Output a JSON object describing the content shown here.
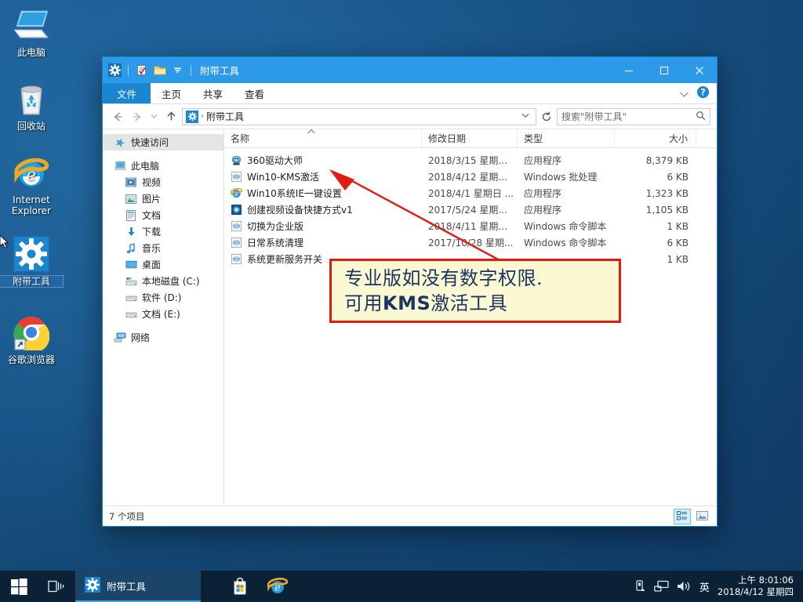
{
  "desktop": {
    "icons": [
      {
        "label": "此电脑",
        "icon": "computer-icon",
        "selected": false
      },
      {
        "label": "回收站",
        "icon": "recycle-bin-icon",
        "selected": false
      },
      {
        "label": "Internet\nExplorer",
        "label_l1": "Internet",
        "label_l2": "Explorer",
        "icon": "internet-explorer-icon",
        "selected": false
      },
      {
        "label": "附带工具",
        "icon": "gear-icon",
        "selected": true
      },
      {
        "label": "谷歌浏览器",
        "icon": "chrome-icon",
        "selected": false
      }
    ]
  },
  "explorer": {
    "window_title": "附带工具",
    "quick_access_toolbar": {
      "folder_icon": "gear-icon",
      "properties_icon": "properties-icon",
      "new_folder_icon": "new-folder-icon",
      "customize_icon": "chevron-down-icon"
    },
    "window_controls": {
      "minimize": "–",
      "maximize": "❐",
      "close": "✕"
    },
    "ribbon": {
      "tabs": [
        {
          "label": "文件",
          "active": true
        },
        {
          "label": "主页",
          "active": false
        },
        {
          "label": "共享",
          "active": false
        },
        {
          "label": "查看",
          "active": false
        }
      ],
      "collapse_icon": "chevron-down-icon",
      "help_icon": "help-icon"
    },
    "navigation": {
      "back_icon": "arrow-left-icon",
      "forward_icon": "arrow-right-icon",
      "recent_icon": "chevron-down-icon",
      "up_icon": "arrow-up-icon",
      "breadcrumb_icon": "gear-icon",
      "breadcrumb_path": "附带工具",
      "breadcrumb_separator": "›",
      "dropdown_icon": "chevron-down-icon",
      "refresh_icon": "refresh-icon"
    },
    "search": {
      "placeholder": "搜索\"附带工具\"",
      "value": "",
      "icon": "search-icon"
    },
    "nav_pane": {
      "items": [
        {
          "label": "快速访问",
          "icon": "star-pin-icon",
          "indent": 0,
          "selected": true
        },
        {
          "label": "此电脑",
          "icon": "computer-icon",
          "indent": 0,
          "selected": false
        },
        {
          "label": "视频",
          "icon": "videos-icon",
          "indent": 1,
          "selected": false
        },
        {
          "label": "图片",
          "icon": "pictures-icon",
          "indent": 1,
          "selected": false
        },
        {
          "label": "文档",
          "icon": "documents-icon",
          "indent": 1,
          "selected": false
        },
        {
          "label": "下载",
          "icon": "downloads-icon",
          "indent": 1,
          "selected": false
        },
        {
          "label": "音乐",
          "icon": "music-icon",
          "indent": 1,
          "selected": false
        },
        {
          "label": "桌面",
          "icon": "desktop-icon",
          "indent": 1,
          "selected": false
        },
        {
          "label": "本地磁盘 (C:)",
          "icon": "local-disk-icon",
          "indent": 1,
          "selected": false
        },
        {
          "label": "软件 (D:)",
          "icon": "drive-icon",
          "indent": 1,
          "selected": false
        },
        {
          "label": "文档 (E:)",
          "icon": "drive-icon",
          "indent": 1,
          "selected": false
        },
        {
          "label": "网络",
          "icon": "network-icon",
          "indent": 0,
          "selected": false
        }
      ]
    },
    "columns": [
      {
        "label": "名称",
        "sorted": true,
        "sort_direction": "asc"
      },
      {
        "label": "修改日期",
        "sorted": false
      },
      {
        "label": "类型",
        "sorted": false
      },
      {
        "label": "大小",
        "sorted": false
      }
    ],
    "files": [
      {
        "name": "360驱动大师",
        "icon": "app-360-icon",
        "date": "2018/3/15 星期...",
        "type": "应用程序",
        "size": "8,379 KB"
      },
      {
        "name": "Win10-KMS激活",
        "icon": "batch-script-icon",
        "date": "2018/4/12 星期...",
        "type": "Windows 批处理",
        "size": "6 KB"
      },
      {
        "name": "Win10系统IE一键设置",
        "icon": "internet-explorer-icon",
        "date": "2018/4/1 星期日 ...",
        "type": "应用程序",
        "size": "1,323 KB"
      },
      {
        "name": "创建视频设备快捷方式v1",
        "icon": "app-blue-icon",
        "date": "2017/5/24 星期...",
        "type": "应用程序",
        "size": "1,105 KB"
      },
      {
        "name": "切换为企业版",
        "icon": "batch-script-icon",
        "date": "2018/4/11 星期...",
        "type": "Windows 命令脚本",
        "size": "1 KB"
      },
      {
        "name": "日常系统清理",
        "icon": "batch-script-icon",
        "date": "2017/10/28 星期...",
        "type": "Windows 命令脚本",
        "size": "6 KB"
      },
      {
        "name": "系统更新服务开关",
        "icon": "batch-script-icon",
        "date": "",
        "type": "",
        "size": "1 KB"
      }
    ],
    "status": {
      "item_count": "7 个项目",
      "details_view_icon": "details-view-icon",
      "large_icons_view_icon": "large-icons-view-icon"
    }
  },
  "annotation": {
    "line1": "专业版如没有数字权限.",
    "line2_pre": "可用",
    "line2_bold": "KMS",
    "line2_post": "激活工具",
    "box_fill": "#fbf8d4",
    "box_border": "#e01b10",
    "text_color": "#1c3560",
    "arrow_color": "#e01b10"
  },
  "taskbar": {
    "start_icon": "windows-start-icon",
    "task_view_icon": "task-view-icon",
    "active_task": {
      "label": "附带工具",
      "icon": "gear-icon"
    },
    "pinned": [
      {
        "label": "Microsoft Store",
        "icon": "store-icon"
      },
      {
        "label": "Internet Explorer",
        "icon": "internet-explorer-icon"
      }
    ],
    "tray": {
      "usb_icon": "usb-eject-icon",
      "network_icon": "network-icon",
      "volume_icon": "volume-icon",
      "ime_label": "英",
      "time": "上午 8:01:06",
      "date": "2018/4/12 星期四"
    }
  }
}
